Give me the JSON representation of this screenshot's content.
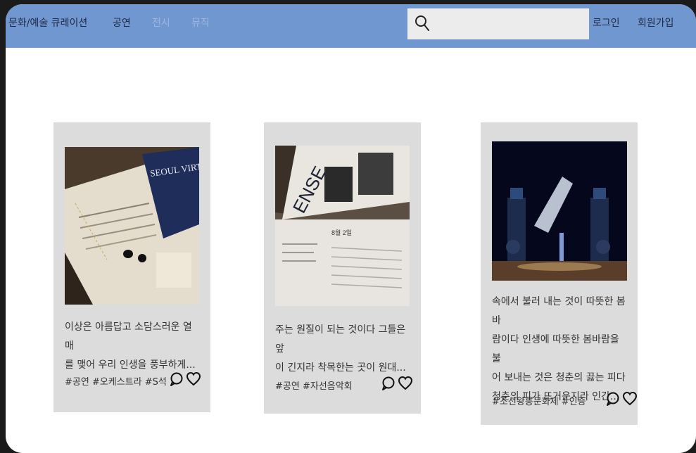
{
  "nav": {
    "brand": "문화/예술 큐레이션",
    "menu": [
      "공연",
      "전시",
      "뮤직"
    ],
    "search_placeholder": "",
    "login": "로그인",
    "signup": "회원가입"
  },
  "cards": [
    {
      "text_line1": "이상은 아름답고 소담스러운 열매",
      "text_line2": "를 맺어 우리 인생을 풍부하게...",
      "tags": "#공연 #오케스트라 #S석"
    },
    {
      "text_line1": "주는 원질이 되는 것이다 그들은 앞",
      "text_line2": "이 긴지라 착목한는 곳이 원대...",
      "tags": "#공연 #자선음악회"
    },
    {
      "text_line1": "속에서 불러 내는 것이 따뜻한 봄바",
      "text_line2": "람이다 인생에 따뜻한 봄바람을 불",
      "text_line3": "어 보내는 것은 청춘의 끓는 피다",
      "text_line4": "청춘의 피가 뜨거운지라 인간...",
      "tags": "#조선왕릉문화제 #인증"
    }
  ],
  "photo_texts": {
    "card1_poster": "SEOUL VIRTUOSI",
    "card2_poster": "ENSE",
    "card2_date": "8월 2일"
  },
  "colors": {
    "nav_bg": "#7197d1",
    "card_bg": "#dcdcdc",
    "search_bg": "#ececec"
  }
}
